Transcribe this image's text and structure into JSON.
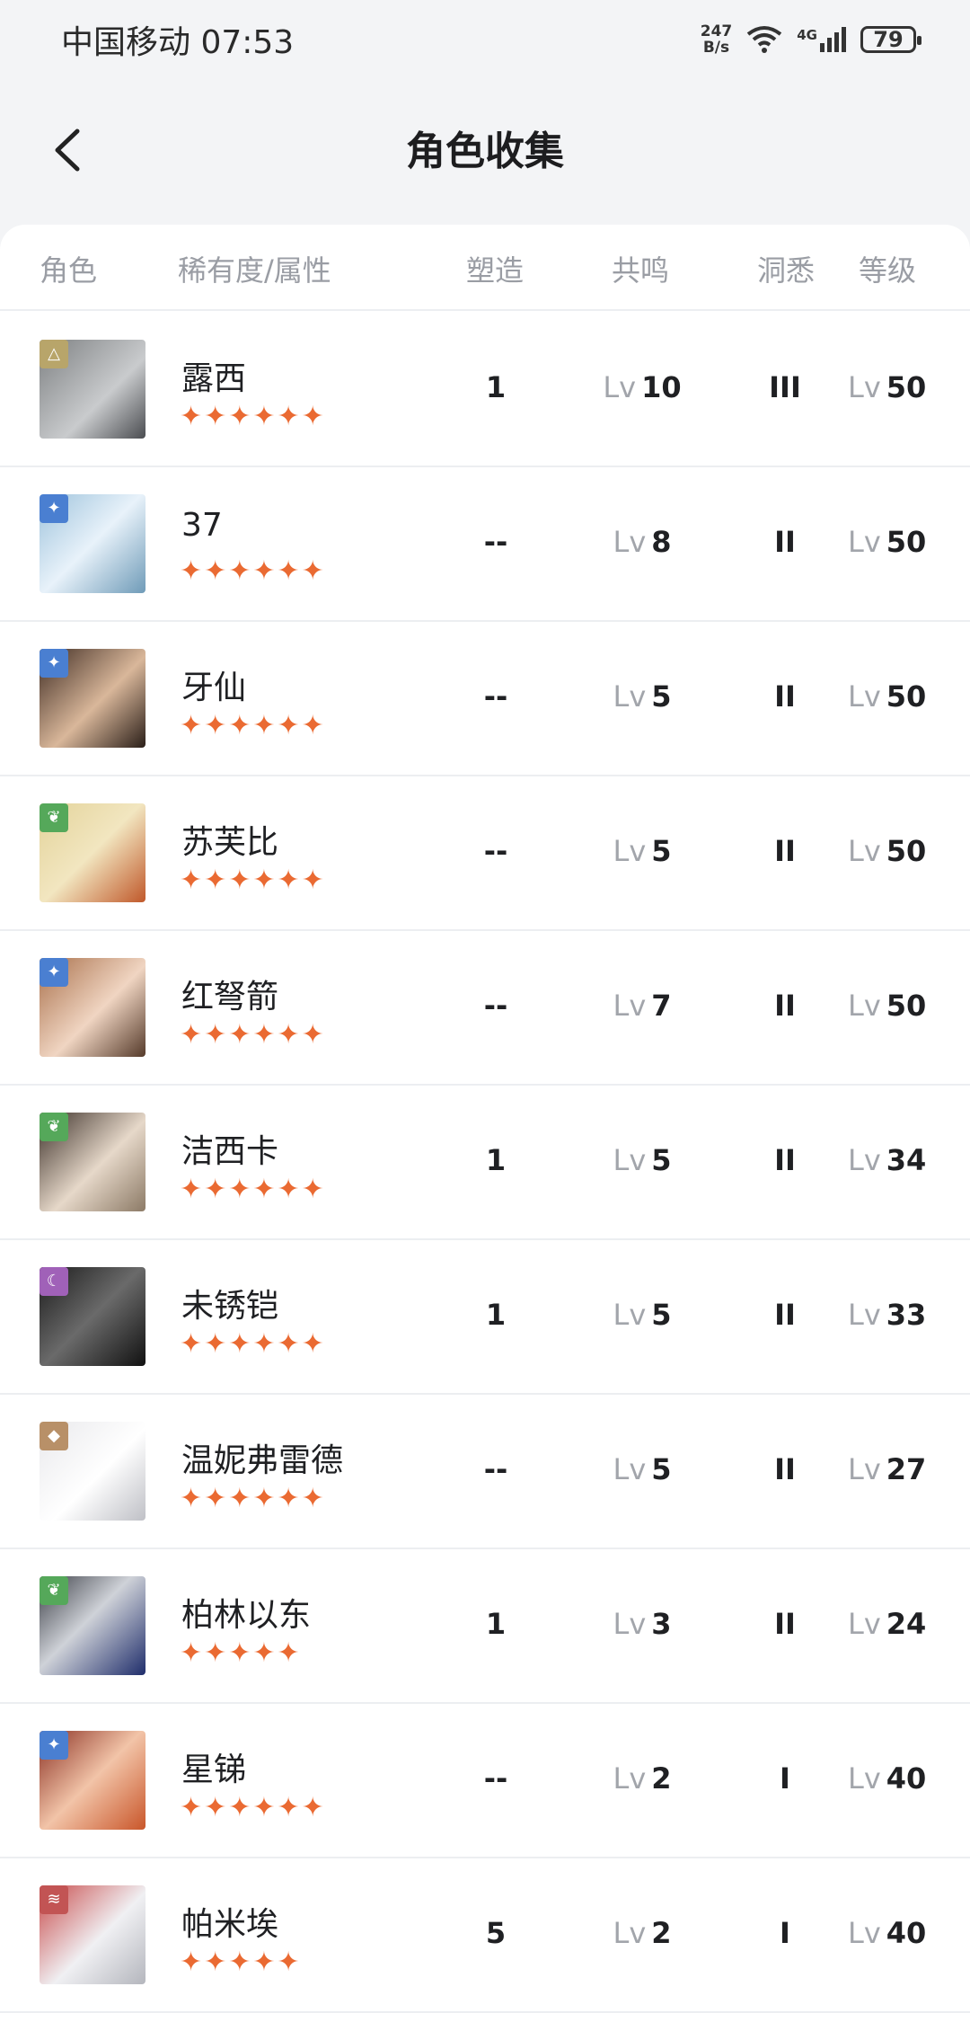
{
  "status_bar": {
    "carrier_time": "中国移动 07:53",
    "net_speed_value": "247",
    "net_speed_unit": "B/s",
    "network": "4G",
    "battery": "79"
  },
  "header": {
    "title": "角色收集"
  },
  "columns": [
    "角色",
    "稀有度/属性",
    "塑造",
    "共鸣",
    "洞悉",
    "等级"
  ],
  "lv_prefix": "Lv",
  "element_colors": {
    "star": "#b8a56a",
    "cosmic": "#4a7fd1",
    "plant": "#55a85a",
    "mineral": "#b89068",
    "moon": "#a061b8",
    "beast": "#c25454"
  },
  "rows": [
    {
      "name": "露西",
      "stars": "✦✦✦✦✦✦",
      "shape": "1",
      "resonance": "10",
      "insight": "III",
      "level": "50",
      "element": "star-icon"
    },
    {
      "name": "37",
      "stars": "✦✦✦✦✦✦",
      "shape": "--",
      "resonance": "8",
      "insight": "II",
      "level": "50",
      "element": "cosmic-icon"
    },
    {
      "name": "牙仙",
      "stars": "✦✦✦✦✦✦",
      "shape": "--",
      "resonance": "5",
      "insight": "II",
      "level": "50",
      "element": "cosmic-icon"
    },
    {
      "name": "苏芙比",
      "stars": "✦✦✦✦✦✦",
      "shape": "--",
      "resonance": "5",
      "insight": "II",
      "level": "50",
      "element": "plant-icon"
    },
    {
      "name": "红弩箭",
      "stars": "✦✦✦✦✦✦",
      "shape": "--",
      "resonance": "7",
      "insight": "II",
      "level": "50",
      "element": "cosmic-icon"
    },
    {
      "name": "洁西卡",
      "stars": "✦✦✦✦✦✦",
      "shape": "1",
      "resonance": "5",
      "insight": "II",
      "level": "34",
      "element": "plant-icon"
    },
    {
      "name": "未锈铠",
      "stars": "✦✦✦✦✦✦",
      "shape": "1",
      "resonance": "5",
      "insight": "II",
      "level": "33",
      "element": "moon-icon"
    },
    {
      "name": "温妮弗雷德",
      "stars": "✦✦✦✦✦✦",
      "shape": "--",
      "resonance": "5",
      "insight": "II",
      "level": "27",
      "element": "mineral-icon"
    },
    {
      "name": "柏林以东",
      "stars": "✦✦✦✦✦",
      "shape": "1",
      "resonance": "3",
      "insight": "II",
      "level": "24",
      "element": "plant-icon"
    },
    {
      "name": "星锑",
      "stars": "✦✦✦✦✦✦",
      "shape": "--",
      "resonance": "2",
      "insight": "I",
      "level": "40",
      "element": "cosmic-icon"
    },
    {
      "name": "帕米埃",
      "stars": "✦✦✦✦✦",
      "shape": "5",
      "resonance": "2",
      "insight": "I",
      "level": "40",
      "element": "beast-icon"
    }
  ]
}
